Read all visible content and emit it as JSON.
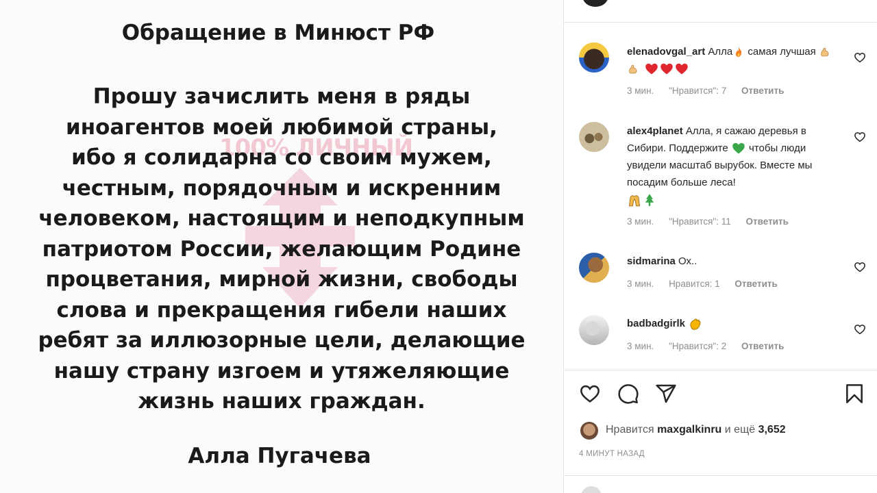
{
  "post": {
    "title": "Обращение в Минюст РФ",
    "body_lines": [
      "Прошу зачислить меня в ряды",
      "иноагентов моей любимой страны,",
      "ибо я солидарна со своим мужем,",
      "честным, порядочным и искренним",
      "человеком, настоящим и неподкупным",
      "патриотом России, желающим Родине",
      "процветания, мирной жизни, свободы",
      "слова и прекращения гибели наших",
      "ребят за иллюзорные цели, делающие",
      "нашу страну изгоем и утяжеляющие",
      "жизнь наших граждан."
    ],
    "signature": "Алла Пугачева",
    "watermark_text": "100% ЛИЧНЫЙ"
  },
  "comments": [
    {
      "username": "elenadovgal_art",
      "text_a": "Алла",
      "text_b": "самая лучшая",
      "time": "3 мин.",
      "likes": "\"Нравится\": 7",
      "reply": "Ответить"
    },
    {
      "username": "alex4planet",
      "text_a": "Алла, я сажаю деревья в Сибири. Поддержите",
      "text_b": "чтобы люди увидели масштаб вырубок. Вместе мы посадим больше леса!",
      "time": "3 мин.",
      "likes": "\"Нравится\": 11",
      "reply": "Ответить"
    },
    {
      "username": "sidmarina",
      "text_a": "Ох..",
      "time": "3 мин.",
      "likes": "Нравится: 1",
      "reply": "Ответить"
    },
    {
      "username": "badbadgirlk",
      "text_a": "",
      "time": "3 мин.",
      "likes": "\"Нравится\": 2",
      "reply": "Ответить"
    }
  ],
  "likes": {
    "prefix": "Нравится",
    "user": "maxgalkinru",
    "middle": "и ещё",
    "count": "3,652"
  },
  "timestamp": "4 МИНУТ НАЗАД",
  "colors": {
    "heart_red": "#e0262f",
    "tree_green": "#3aa84a",
    "clap_yellow": "#f4b400",
    "watermark_pink": "#e0567a"
  },
  "icons": [
    "heart-icon",
    "comment-icon",
    "share-icon",
    "bookmark-icon"
  ]
}
